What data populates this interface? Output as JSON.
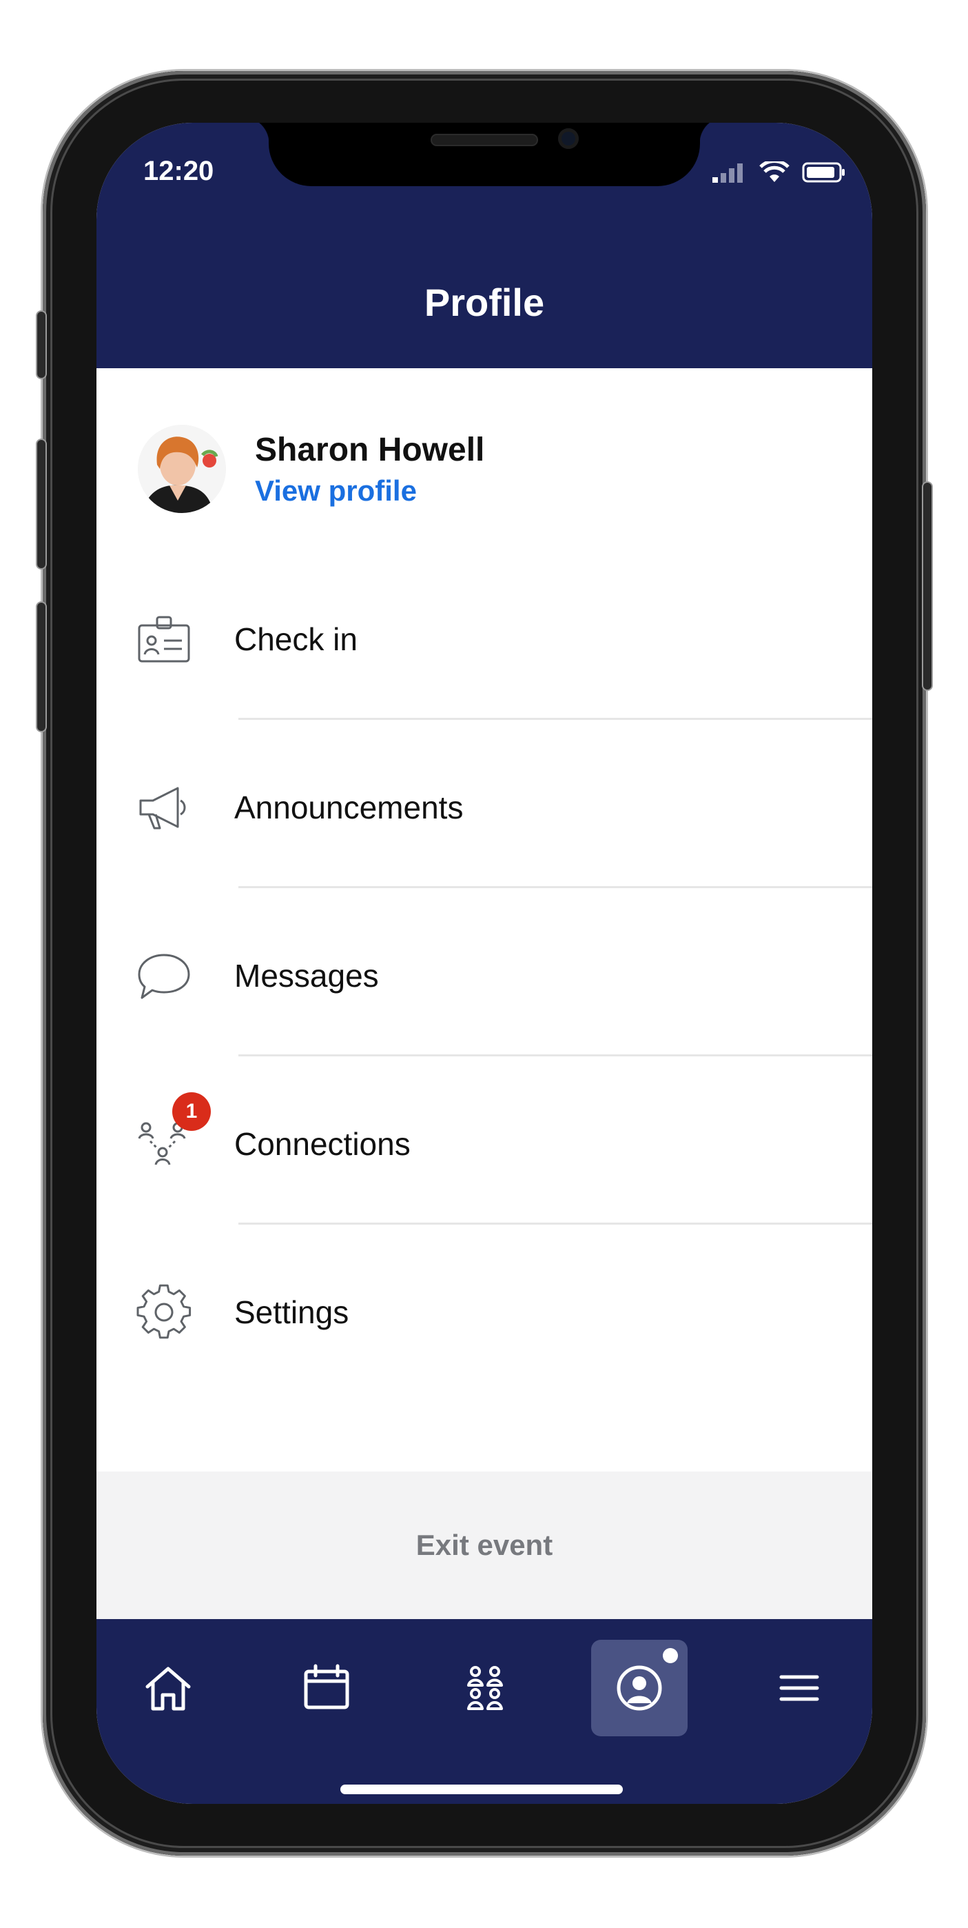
{
  "status": {
    "time": "12:20"
  },
  "header": {
    "title": "Profile"
  },
  "user": {
    "name": "Sharon Howell",
    "view_profile_label": "View profile"
  },
  "menu": {
    "items": [
      {
        "label": "Check in",
        "icon": "id-badge-icon"
      },
      {
        "label": "Announcements",
        "icon": "megaphone-icon"
      },
      {
        "label": "Messages",
        "icon": "chat-bubble-icon"
      },
      {
        "label": "Connections",
        "icon": "people-network-icon",
        "badge": "1"
      },
      {
        "label": "Settings",
        "icon": "gear-icon"
      }
    ]
  },
  "footer": {
    "exit_label": "Exit event"
  },
  "tabbar": {
    "tabs": [
      {
        "name": "home",
        "icon": "home-icon"
      },
      {
        "name": "schedule",
        "icon": "calendar-icon"
      },
      {
        "name": "attendees",
        "icon": "people-icon"
      },
      {
        "name": "profile",
        "icon": "profile-icon",
        "active": true
      },
      {
        "name": "menu",
        "icon": "hamburger-icon"
      }
    ]
  },
  "colors": {
    "brand": "#1a2258",
    "link": "#1a6fe0",
    "badge": "#d92c1a",
    "exit_bg": "#f3f3f4"
  }
}
